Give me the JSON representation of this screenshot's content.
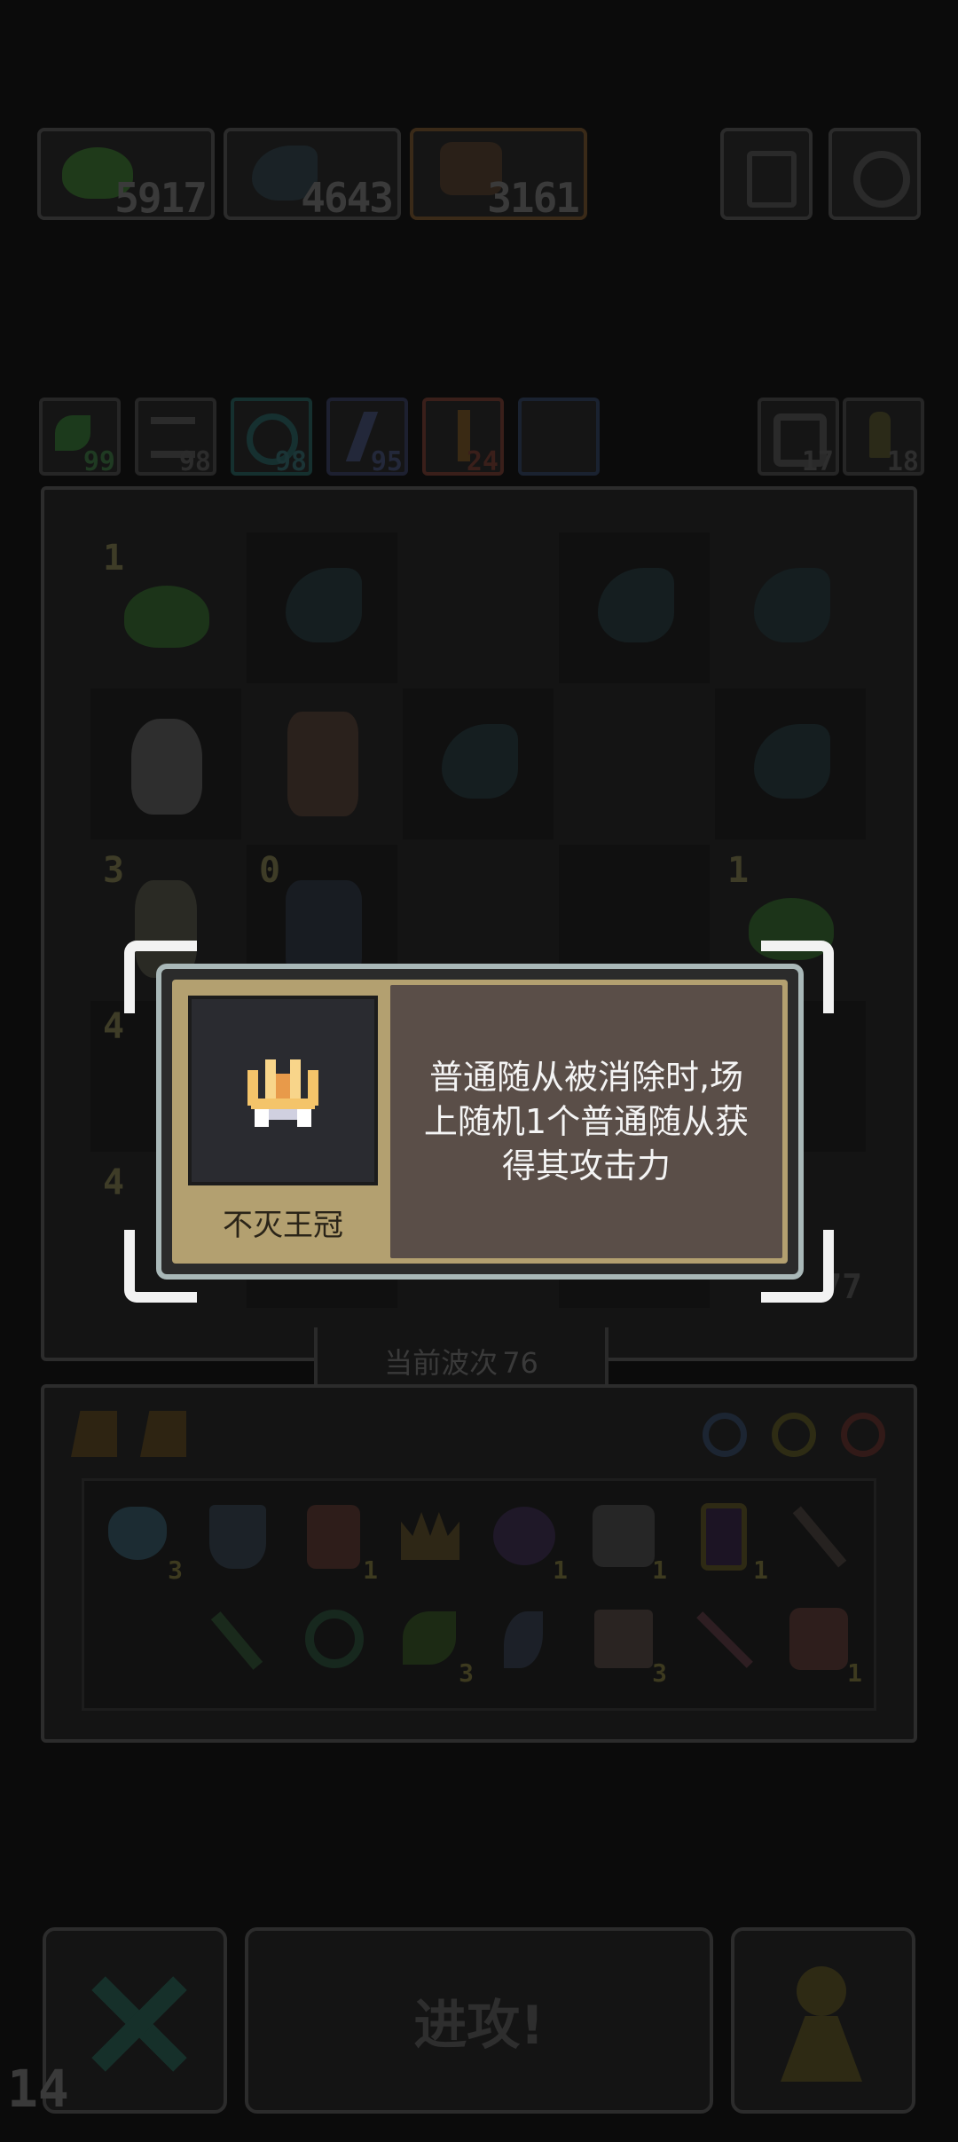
{
  "resources": [
    {
      "name": "green-slime",
      "value": "5917"
    },
    {
      "name": "dark-wave",
      "value": "4643"
    },
    {
      "name": "orc",
      "value": "3161"
    }
  ],
  "top_buttons": [
    {
      "icon": "help-icon"
    },
    {
      "icon": "settings-icon"
    }
  ],
  "synergies": [
    {
      "icon": "leaf-icon",
      "value": "99",
      "color": "#1f3a22"
    },
    {
      "icon": "wing-icon",
      "value": "98",
      "color": "#2c2c2c"
    },
    {
      "icon": "swirl-icon",
      "value": "98",
      "color": "#1b3436"
    },
    {
      "icon": "lightning-icon",
      "value": "95",
      "color": "#23283a"
    },
    {
      "icon": "sword-icon",
      "value": "24",
      "color": "#3a1f1a"
    },
    {
      "icon": "blank",
      "value": "",
      "color": "#1a2230"
    }
  ],
  "side_counters": [
    {
      "icon": "refresh-icon",
      "value": "17"
    },
    {
      "icon": "pawn-icon",
      "value": "18"
    }
  ],
  "board_numbers": {
    "r0c0": "1",
    "r2c0": "3",
    "r2c1": "0",
    "r2c4": "1",
    "r3c0": "4",
    "r4c0": "4",
    "r4c4": "77"
  },
  "wave": {
    "label": "当前波次",
    "number": "76"
  },
  "tooltip": {
    "item_name": "不灭王冠",
    "description_line1": "普通随从被消除时,场",
    "description_line2": "上随机1个普通随从获",
    "description_line3": "得其攻击力"
  },
  "items_row1_counts": [
    "3",
    "",
    "1",
    "",
    "1",
    "1",
    "1",
    ""
  ],
  "items_row2_counts": [
    "",
    "",
    "3",
    "",
    "3",
    "",
    "1"
  ],
  "buttons": {
    "attack": "进攻!",
    "fps": "14"
  }
}
